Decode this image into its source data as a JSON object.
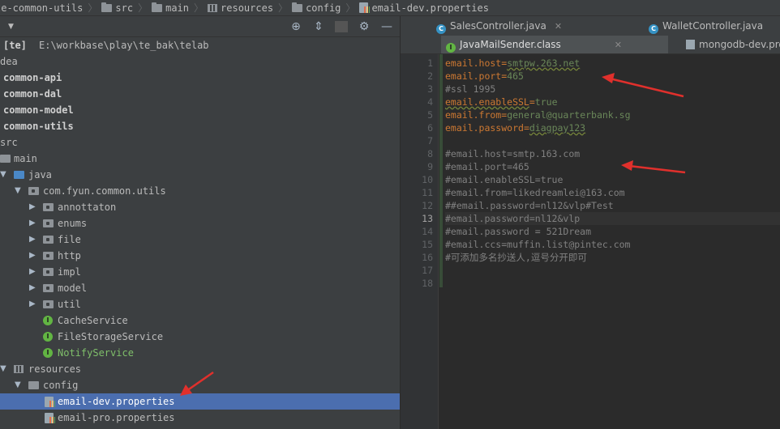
{
  "breadcrumb": [
    {
      "label": "te-common-utils",
      "icon": "folder-icon"
    },
    {
      "label": "src",
      "icon": "folder-icon"
    },
    {
      "label": "main",
      "icon": "folder-icon"
    },
    {
      "label": "resources",
      "icon": "resources-folder-icon"
    },
    {
      "label": "config",
      "icon": "folder-icon"
    },
    {
      "label": "email-dev.properties",
      "icon": "properties-file-icon"
    }
  ],
  "panel": {
    "header_icons": [
      "locate-icon",
      "collapse-icon",
      "gear-icon",
      "hide-icon"
    ]
  },
  "tree": {
    "root_name": "[te]",
    "root_path": "E:\\workbase\\play\\te_bak\\telab",
    "idea": "dea",
    "modules": [
      "common-api",
      "common-dal",
      "common-model",
      "common-utils"
    ],
    "src": "src",
    "main": "main",
    "java": "java",
    "package": "com.fyun.common.utils",
    "subpackages": [
      "annottaton",
      "enums",
      "file",
      "http",
      "impl",
      "model",
      "util"
    ],
    "services": [
      "CacheService",
      "FileStorageService",
      "NotifyService"
    ],
    "resources": "resources",
    "config": "config",
    "files": [
      "email-dev.properties",
      "email-pro.properties"
    ]
  },
  "tabs": {
    "row1": [
      {
        "label": "SalesController.java",
        "icon": "class-icon"
      },
      {
        "label": "WalletController.java",
        "icon": "class-icon"
      }
    ],
    "row2": [
      {
        "label": "JavaMailSender.class",
        "icon": "interface-icon"
      },
      {
        "label": "mongodb-dev.pro",
        "icon": "properties-file-icon"
      }
    ]
  },
  "editor": {
    "lines": [
      {
        "n": "1",
        "key": "email.host",
        "value": "smtpw.263.net"
      },
      {
        "n": "2",
        "key": "email.port",
        "value": "465"
      },
      {
        "n": "3",
        "comment": "#ssl 1995"
      },
      {
        "n": "4",
        "key": "email.enableSSL",
        "value": "true"
      },
      {
        "n": "5",
        "key": "email.from",
        "value": "general@quarterbank.sg"
      },
      {
        "n": "6",
        "key": "email.password",
        "value": "diagpay123"
      },
      {
        "n": "7",
        "comment": ""
      },
      {
        "n": "8",
        "comment": "#email.host=smtp.163.com"
      },
      {
        "n": "9",
        "comment": "#email.port=465"
      },
      {
        "n": "10",
        "comment": "#email.enableSSL=true"
      },
      {
        "n": "11",
        "comment": "#email.from=likedreamlei@163.com"
      },
      {
        "n": "12",
        "comment": "##email.password=nl12&vlp#Test"
      },
      {
        "n": "13",
        "comment": "#email.password=nl12&vlp"
      },
      {
        "n": "14",
        "comment": "#email.password = 521Dream"
      },
      {
        "n": "15",
        "comment": "#email.ccs=muffin.list@pintec.com"
      },
      {
        "n": "16",
        "comment": "#可添加多名抄送人,逗号分开即可"
      },
      {
        "n": "17",
        "comment": ""
      },
      {
        "n": "18",
        "comment": ""
      }
    ],
    "current_line": "13"
  },
  "colors": {
    "annotation_arrow": "#e0302c",
    "selection": "#4b6eaf",
    "key": "#cc7832",
    "value": "#6a8759",
    "comment": "#808080"
  }
}
